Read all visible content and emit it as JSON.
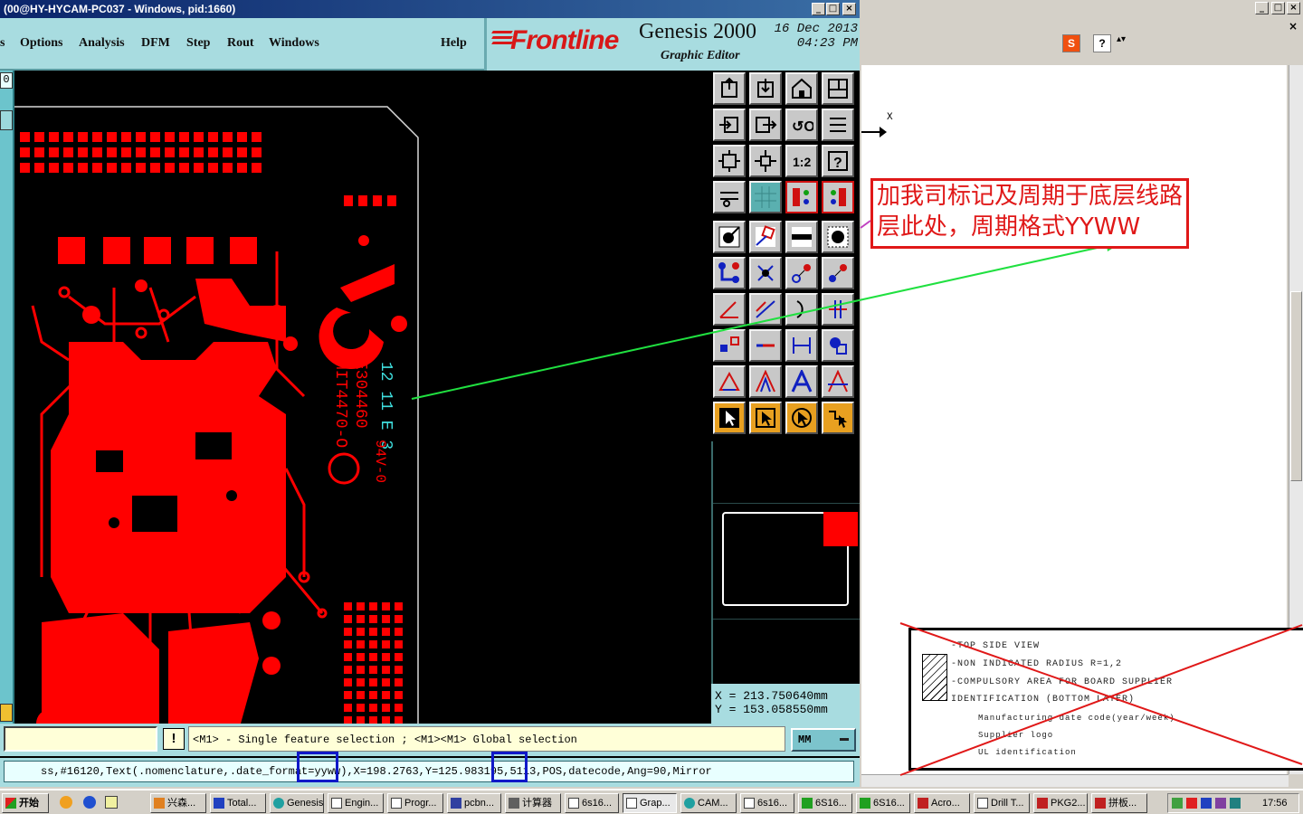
{
  "genesis": {
    "title": "(00@HY-HYCAM-PC037 - Windows, pid:1660)",
    "menu": [
      "s",
      "Options",
      "Analysis",
      "DFM",
      "Step",
      "Rout",
      "Windows",
      "Help"
    ],
    "brand": {
      "logo": "Frontline",
      "product": "Genesis 2000",
      "subtitle": "Graphic Editor",
      "date_line1": "16 Dec 2013",
      "date_line2": "04:23 PM"
    },
    "left_strip_label": "0",
    "board_text": {
      "part": "MIT4470-O",
      "code": "E304460",
      "datecode": "12 11 E 3",
      "ul_mark": "94V-0"
    },
    "coords": {
      "x_label": "X",
      "x_value": "213.750640mm",
      "y_label": "Y",
      "y_value": "153.058550mm"
    },
    "status_hint": "<M1> - Single feature selection ; <M1><M1> Global selection",
    "warn_symbol": "!",
    "units": "MM",
    "info_line": "ss,#16120,Text(.nomenclature,.date_format=yyww),X=198.2763,Y=125.983195,5113,POS,datecode,Ang=90,Mirror",
    "highlight_tokens": [
      "yyww",
      "5113"
    ]
  },
  "right_window": {
    "axis_label": "X",
    "callout_text": "加我司标记及周期于底层线路层此处，周期格式YYWW",
    "notes": [
      "-TOP SIDE VIEW",
      "-NON INDICATED RADIUS R=1,2",
      "-COMPULSORY AREA FOR BOARD SUPPLIER",
      " IDENTIFICATION (BOTTOM LAYER)",
      "Manufacturing date code(year/week)",
      "Supplier logo",
      "UL identification"
    ]
  },
  "taskbar": {
    "start_label": "开始",
    "tasks": [
      "兴森...",
      "Total...",
      "Genesis",
      "Engin...",
      "Progr...",
      "pcbn...",
      "计算器",
      "6s16...",
      "Grap...",
      "CAM...",
      "6s16...",
      "6S16...",
      "6S16...",
      "Acro...",
      "Drill T...",
      "PKG2...",
      "拼板..."
    ],
    "clock": "17:56"
  },
  "colors": {
    "copper": "#ff0000",
    "silkscreen": "#40e0e0",
    "accent_teal": "#a8dce0",
    "callout_red": "#e01818",
    "arrow_green": "#20e040",
    "highlight_blue": "#1018c8"
  }
}
